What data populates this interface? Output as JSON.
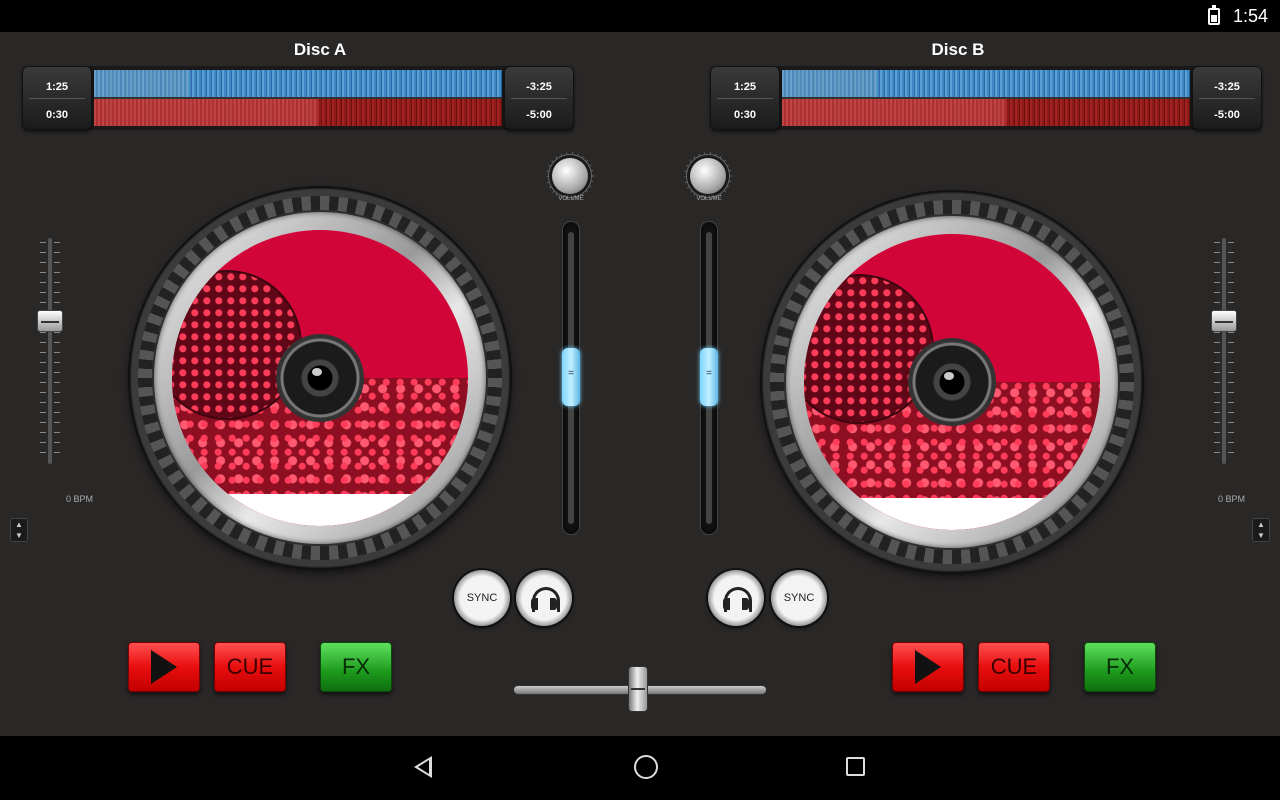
{
  "status_bar": {
    "time": "1:54",
    "battery_icon": "battery-charging-icon"
  },
  "deck_a": {
    "title": "Disc A",
    "elapsed_top": "1:25",
    "elapsed_bottom": "0:30",
    "remaining_top": "-3:25",
    "remaining_bottom": "-5:00",
    "top_waveform_played": 0.23,
    "bottom_waveform_played": 0.55,
    "bpm_text": "0 BPM",
    "sync_label": "SYNC",
    "cue_label": "CUE",
    "fx_label": "FX",
    "volume_label": "VOLUME"
  },
  "deck_b": {
    "title": "Disc B",
    "elapsed_top": "1:25",
    "elapsed_bottom": "0:30",
    "remaining_top": "-3:25",
    "remaining_bottom": "-5:00",
    "top_waveform_played": 0.23,
    "bottom_waveform_played": 0.55,
    "bpm_text": "0 BPM",
    "sync_label": "SYNC",
    "cue_label": "CUE",
    "fx_label": "FX",
    "volume_label": "VOLUME"
  },
  "colors": {
    "background": "#2a2727",
    "waveform_top": "#3f88c4",
    "waveform_bottom": "#8e1a1a",
    "platter": "#d20538",
    "fader_accent": "#7fd4ff",
    "play_cue": "#e80e0e",
    "fx": "#1d9a1d"
  },
  "icons": {
    "play": "play-icon",
    "headphones": "headphones-icon",
    "back": "nav-back-icon",
    "home": "nav-home-icon",
    "recents": "nav-recents-icon"
  }
}
